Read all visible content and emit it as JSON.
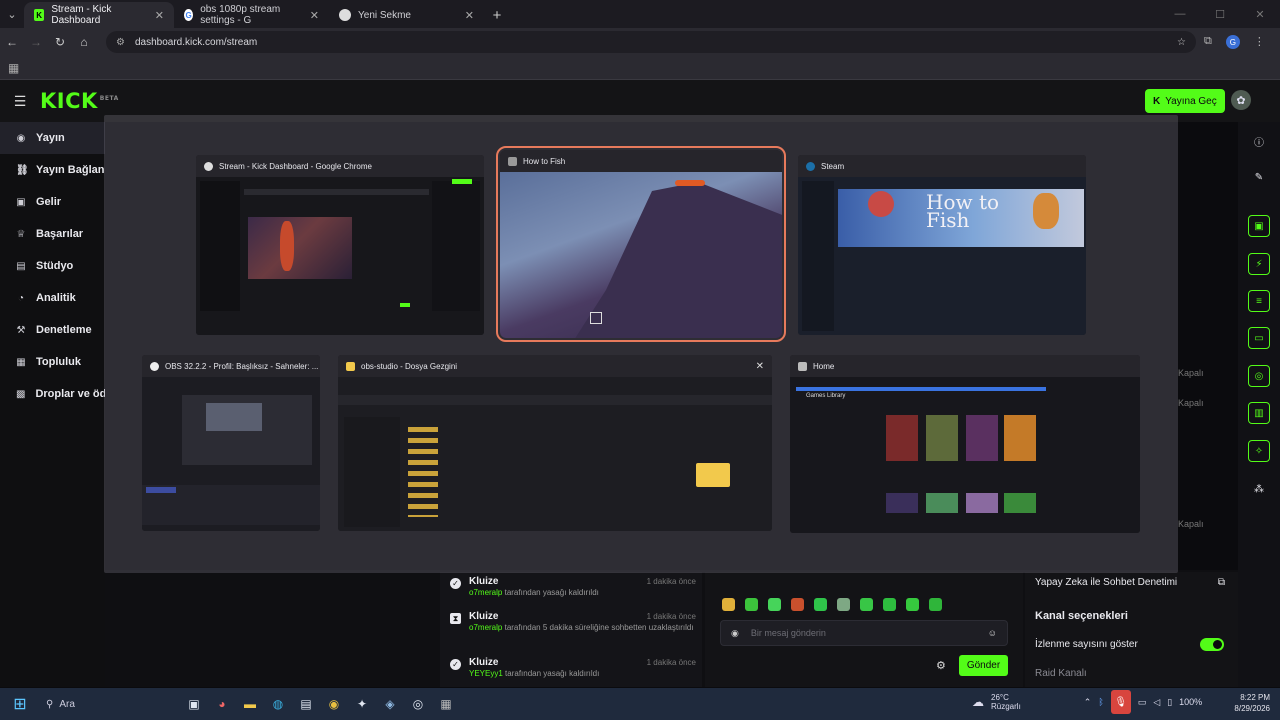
{
  "browser": {
    "tabs": [
      {
        "title": "Stream - Kick Dashboard",
        "favicon": "kick-icon",
        "active": true
      },
      {
        "title": "obs 1080p stream settings - G",
        "favicon": "google-icon",
        "active": false
      },
      {
        "title": "Yeni Sekme",
        "favicon": "chrome-icon",
        "active": false
      }
    ],
    "url": "dashboard.kick.com/stream"
  },
  "kick": {
    "logo": "KICK",
    "beta": "BETA",
    "go_live": "Yayına Geç",
    "sidebar": [
      {
        "label": "Yayın",
        "icon": "broadcast-icon",
        "active": true
      },
      {
        "label": "Yayın Bağlan",
        "icon": "link-icon",
        "active": false
      },
      {
        "label": "Gelir",
        "icon": "revenue-icon",
        "active": false
      },
      {
        "label": "Başarılar",
        "icon": "trophy-icon",
        "active": false
      },
      {
        "label": "Stüdyo",
        "icon": "studio-icon",
        "active": false
      },
      {
        "label": "Analitik",
        "icon": "analytics-icon",
        "active": false
      },
      {
        "label": "Denetleme",
        "icon": "hammer-icon",
        "active": false
      },
      {
        "label": "Topluluk",
        "icon": "community-icon",
        "active": false
      },
      {
        "label": "Droplar ve öd",
        "icon": "gift-icon",
        "active": false
      }
    ],
    "mod_log": [
      {
        "user": "Kluize",
        "time": "1 dakika önce",
        "actor": "o7meralp",
        "text": "tarafından yasağı kaldırıldı",
        "icon": "check-icon"
      },
      {
        "user": "Kluize",
        "time": "1 dakika önce",
        "actor": "o7meralp",
        "text": "tarafından 5 dakika süreliğine sohbetten uzaklaştırıldı",
        "icon": "timer-icon"
      },
      {
        "user": "Kluize",
        "time": "1 dakika önce",
        "actor": "YEYEyy1",
        "text": "tarafından yasağı kaldırıldı",
        "icon": "check-icon"
      }
    ],
    "chat": {
      "placeholder": "Bir mesaj gönderin",
      "send": "Gönder"
    },
    "settings": {
      "ai_mod": "Yapay Zeka ile Sohbet Denetimi",
      "channel_options": "Kanal seçenekleri",
      "show_views": "İzlenme sayısını göster",
      "raid": "Raid Kanalı",
      "side_labels": [
        "Kapalı",
        "Kapalı",
        "Kapalı"
      ]
    }
  },
  "taskview": {
    "windows": [
      {
        "title": "Stream - Kick Dashboard - Google Chrome",
        "icon": "chrome-icon"
      },
      {
        "title": "How to Fish",
        "icon": "game-icon",
        "selected": true
      },
      {
        "title": "Steam",
        "icon": "steam-icon"
      },
      {
        "title": "OBS 32.2.2 - Profil: Başlıksız - Sahneler: ...",
        "icon": "obs-icon"
      },
      {
        "title": "obs-studio - Dosya Gezgini",
        "icon": "folder-icon"
      },
      {
        "title": "Home",
        "icon": "launcher-icon"
      }
    ],
    "thumb_text": {
      "steam_game": "How to\nFish",
      "games_library": "Games Library"
    }
  },
  "taskbar": {
    "search": "Ara",
    "weather_temp": "26°C",
    "weather_desc": "Rüzgarlı",
    "battery": "100%",
    "time": "8:22 PM",
    "date": "8/29/2026"
  }
}
